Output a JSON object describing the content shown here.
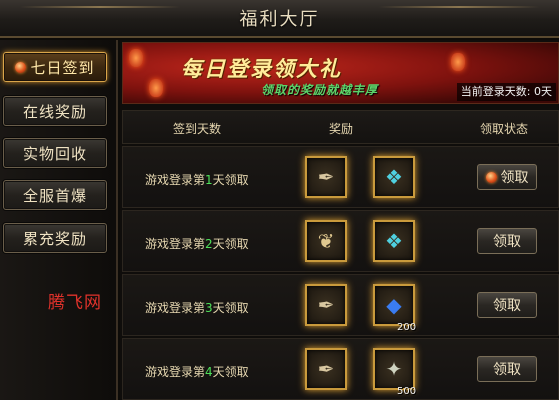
{
  "window": {
    "title": "福利大厅"
  },
  "sidebar": {
    "items": [
      {
        "label": "七日签到",
        "active": true
      },
      {
        "label": "在线奖励",
        "active": false
      },
      {
        "label": "实物回收",
        "active": false
      },
      {
        "label": "全服首爆",
        "active": false
      },
      {
        "label": "累充奖励",
        "active": false
      }
    ]
  },
  "watermark": "腾飞网",
  "banner": {
    "title": "每日登录领大礼",
    "subtitle": "领取的奖励就越丰厚",
    "login_days_text": "当前登录天数: 0天"
  },
  "table": {
    "headers": {
      "days": "签到天数",
      "reward": "奖励",
      "status": "领取状态"
    },
    "rows": [
      {
        "label_prefix": "游戏登录第",
        "day": "1",
        "label_suffix": "天领取",
        "items": [
          {
            "icon": "scroll-icon",
            "qty": ""
          },
          {
            "icon": "teal-crystal-icon",
            "qty": ""
          }
        ],
        "claim_label": "领取",
        "claim_dot": true
      },
      {
        "label_prefix": "游戏登录第",
        "day": "2",
        "label_suffix": "天领取",
        "items": [
          {
            "icon": "sack-icon",
            "qty": ""
          },
          {
            "icon": "teal-crystal-icon",
            "qty": ""
          }
        ],
        "claim_label": "领取",
        "claim_dot": false
      },
      {
        "label_prefix": "游戏登录第",
        "day": "3",
        "label_suffix": "天领取",
        "items": [
          {
            "icon": "scroll-icon",
            "qty": ""
          },
          {
            "icon": "blue-gem-icon",
            "qty": "200"
          }
        ],
        "claim_label": "领取",
        "claim_dot": false
      },
      {
        "label_prefix": "游戏登录第",
        "day": "4",
        "label_suffix": "天领取",
        "items": [
          {
            "icon": "scroll-icon",
            "qty": ""
          },
          {
            "icon": "silver-pack-icon",
            "qty": "500"
          }
        ],
        "claim_label": "领取",
        "claim_dot": false
      }
    ]
  },
  "colors": {
    "accent_gold": "#d9a54a",
    "day_number": "#4fe05a",
    "banner_red": "#c0261c",
    "subtitle_green": "#5cd46a"
  }
}
